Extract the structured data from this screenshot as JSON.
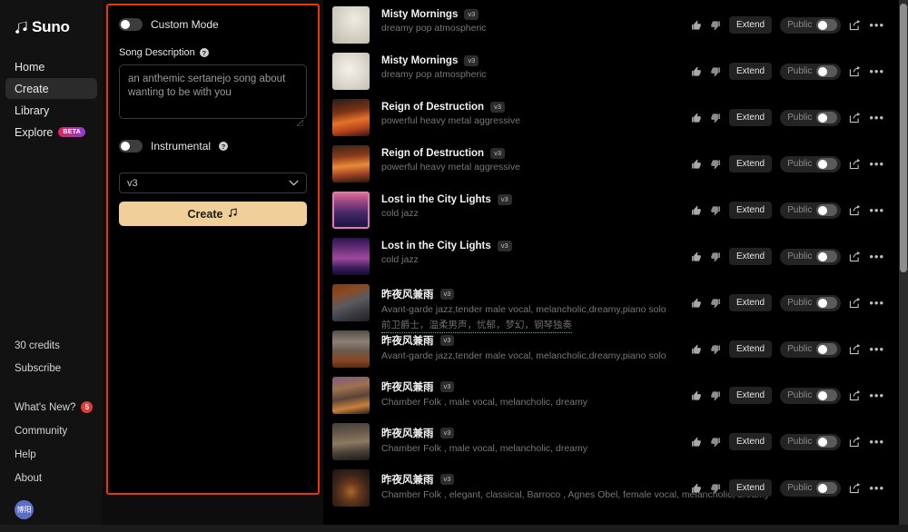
{
  "sidebar": {
    "brand": "Suno",
    "brand_logo_icon": "music-note-logo-icon",
    "nav": [
      {
        "label": "Home",
        "active": false
      },
      {
        "label": "Create",
        "active": true
      },
      {
        "label": "Library",
        "active": false
      },
      {
        "label": "Explore",
        "active": false,
        "badge": "BETA"
      }
    ],
    "credits": "30 credits",
    "subscribe": "Subscribe",
    "links": [
      {
        "label": "What's New?",
        "count": "5"
      },
      {
        "label": "Community",
        "count": null
      },
      {
        "label": "Help",
        "count": null
      },
      {
        "label": "About",
        "count": null
      }
    ],
    "avatar_text": "博阳"
  },
  "create": {
    "custom_mode_label": "Custom Mode",
    "custom_mode_on": false,
    "song_description_label": "Song Description",
    "song_description_value": "an anthemic sertanejo song about wanting to be with you",
    "song_description_placeholder": "an anthemic sertanejo song about wanting to be with you",
    "instrumental_label": "Instrumental",
    "instrumental_on": false,
    "model_version": "v3",
    "create_label": "Create",
    "create_icon": "music-note-icon",
    "help_icon": "help-circle-icon",
    "highlight_color": "#f0330f",
    "create_button_color": "#f0d098"
  },
  "list": {
    "action_labels": {
      "extend": "Extend",
      "public": "Public",
      "thumbs_up_icon": "thumbs-up-icon",
      "thumbs_down_icon": "thumbs-down-icon",
      "share_icon": "share-icon",
      "more_icon": "more-horizontal-icon"
    },
    "songs": [
      {
        "title": "Misty Mornings",
        "version": "v3",
        "style": "dreamy pop atmospheric",
        "translation": null,
        "thumb": "bird-sketch-moon",
        "selected": false,
        "public": false
      },
      {
        "title": "Misty Mornings",
        "version": "v3",
        "style": "dreamy pop atmospheric",
        "translation": null,
        "thumb": "bird-sketch-pale",
        "selected": false,
        "public": false
      },
      {
        "title": "Reign of Destruction",
        "version": "v3",
        "style": "powerful heavy metal aggressive",
        "translation": null,
        "thumb": "fiery-volcano",
        "selected": false,
        "public": false
      },
      {
        "title": "Reign of Destruction",
        "version": "v3",
        "style": "powerful heavy metal aggressive",
        "translation": null,
        "thumb": "fiery-spire",
        "selected": false,
        "public": false
      },
      {
        "title": "Lost in the City Lights",
        "version": "v3",
        "style": "cold jazz",
        "translation": null,
        "thumb": "neon-city-sunset",
        "selected": true,
        "public": false
      },
      {
        "title": "Lost in the City Lights",
        "version": "v3",
        "style": "cold jazz",
        "translation": null,
        "thumb": "neon-city-night",
        "selected": false,
        "public": false
      },
      {
        "title": "昨夜风兼雨",
        "version": "v3",
        "style": "Avant-garde jazz,tender male vocal, melancholic,dreamy,piano solo",
        "translation": "前卫爵士，温柔男声，忧郁，梦幻，钢琴独奏",
        "thumb": "autumn-lantern-night",
        "selected": false,
        "public": false
      },
      {
        "title": "昨夜风兼雨",
        "version": "v3",
        "style": "Avant-garde jazz,tender male vocal, melancholic,dreamy,piano solo",
        "translation": null,
        "thumb": "autumn-window-view",
        "selected": false,
        "public": false
      },
      {
        "title": "昨夜风兼雨",
        "version": "v3",
        "style": "Chamber Folk , male vocal, melancholic, dreamy",
        "translation": null,
        "thumb": "sunset-river",
        "selected": false,
        "public": false
      },
      {
        "title": "昨夜风兼雨",
        "version": "v3",
        "style": "Chamber Folk , male vocal, melancholic, dreamy",
        "translation": null,
        "thumb": "dusk-river-lights",
        "selected": false,
        "public": false
      },
      {
        "title": "昨夜风兼雨",
        "version": "v3",
        "style": "Chamber Folk , elegant, classical, Barroco , Agnes Obel, female vocal, melancholic, dreamy",
        "translation": null,
        "thumb": "forest-lanterns",
        "selected": false,
        "public": false
      }
    ]
  }
}
